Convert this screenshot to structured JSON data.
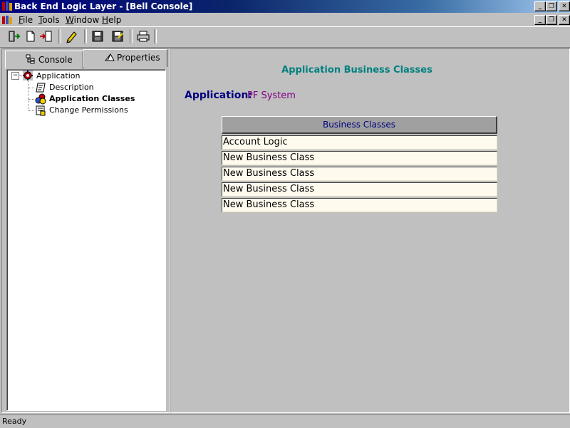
{
  "window": {
    "title": "Back End Logic Layer - [Bell Console]"
  },
  "menu": {
    "items": [
      "File",
      "Tools",
      "Window",
      "Help"
    ],
    "mnemonics": [
      "F",
      "T",
      "W",
      "H"
    ]
  },
  "toolbar": {
    "buttons": [
      "exit-icon",
      "new-document-icon",
      "import-icon",
      "edit-icon",
      "save-icon",
      "save-as-icon",
      "print-icon"
    ]
  },
  "left_panel": {
    "tabs": [
      {
        "label": "Console",
        "icon": "tree-icon",
        "active": false
      },
      {
        "label": "Properties",
        "icon": "properties-icon",
        "active": true
      }
    ],
    "tree": {
      "root": {
        "label": "Application",
        "expanded": true,
        "icon": "application-gear-icon"
      },
      "children": [
        {
          "label": "Description",
          "icon": "description-icon",
          "selected": false
        },
        {
          "label": "Application Classes",
          "icon": "classes-icon",
          "selected": true
        },
        {
          "label": "Change Permissions",
          "icon": "permissions-icon",
          "selected": false
        }
      ]
    }
  },
  "content": {
    "title": "Application Business Classes",
    "application_label": "Application:",
    "application_value": "PF System",
    "table": {
      "header": "Business Classes",
      "rows": [
        "Account Logic",
        "New Business Class",
        "New Business Class",
        "New Business Class",
        "New Business Class"
      ]
    }
  },
  "status": {
    "text": "Ready"
  },
  "colors": {
    "title_bar": "#000080",
    "content_title": "#008080",
    "application_label": "#000080",
    "application_value": "#800080",
    "table_row_bg": "#fffaee"
  }
}
